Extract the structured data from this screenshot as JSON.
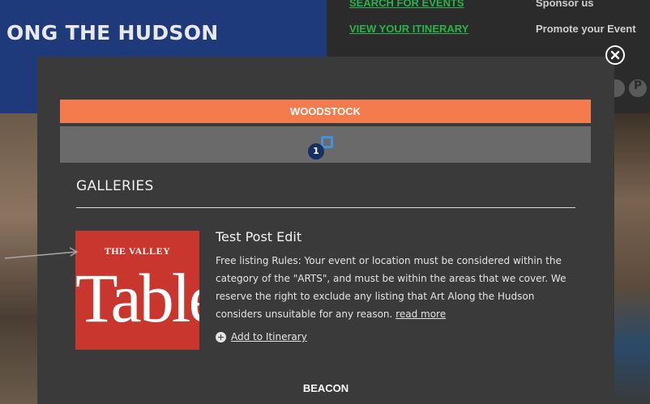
{
  "background": {
    "site_title": "ONG THE HUDSON",
    "nav": {
      "search_events": "SEARCH FOR EVENTS",
      "view_itinerary": "VIEW YOUR ITINERARY",
      "sponsor_us": "Sponsor us",
      "promote_event": "Promote your Event"
    },
    "social_icons": [
      "circle-icon",
      "pinterest-icon"
    ],
    "social_glyph": "P"
  },
  "modal": {
    "close_icon": "close-icon",
    "location_bar": "WOODSTOCK",
    "map_pin_badge": "1",
    "section_title": "GALLERIES",
    "listing": {
      "thumb_top": "THE VALLEY",
      "thumb_big": "Table",
      "title": "Test Post Edit",
      "description": "Free listing Rules: Your event or location must be considered within the category of the \"ARTS\", and must be within the areas that we cover. We reserve the right to exclude any listing that Art Along the Hudson considers unsuitable for any reason. ",
      "read_more": "read more",
      "add_to_itinerary": "Add to Itinerary"
    },
    "next_location": "BEACON"
  },
  "colors": {
    "accent_orange": "#f47b4d",
    "header_blue": "#1f3a7a",
    "link_green": "#2bb24c",
    "modal_bg": "#3a3a3a",
    "map_bar": "#6a6a6a"
  }
}
